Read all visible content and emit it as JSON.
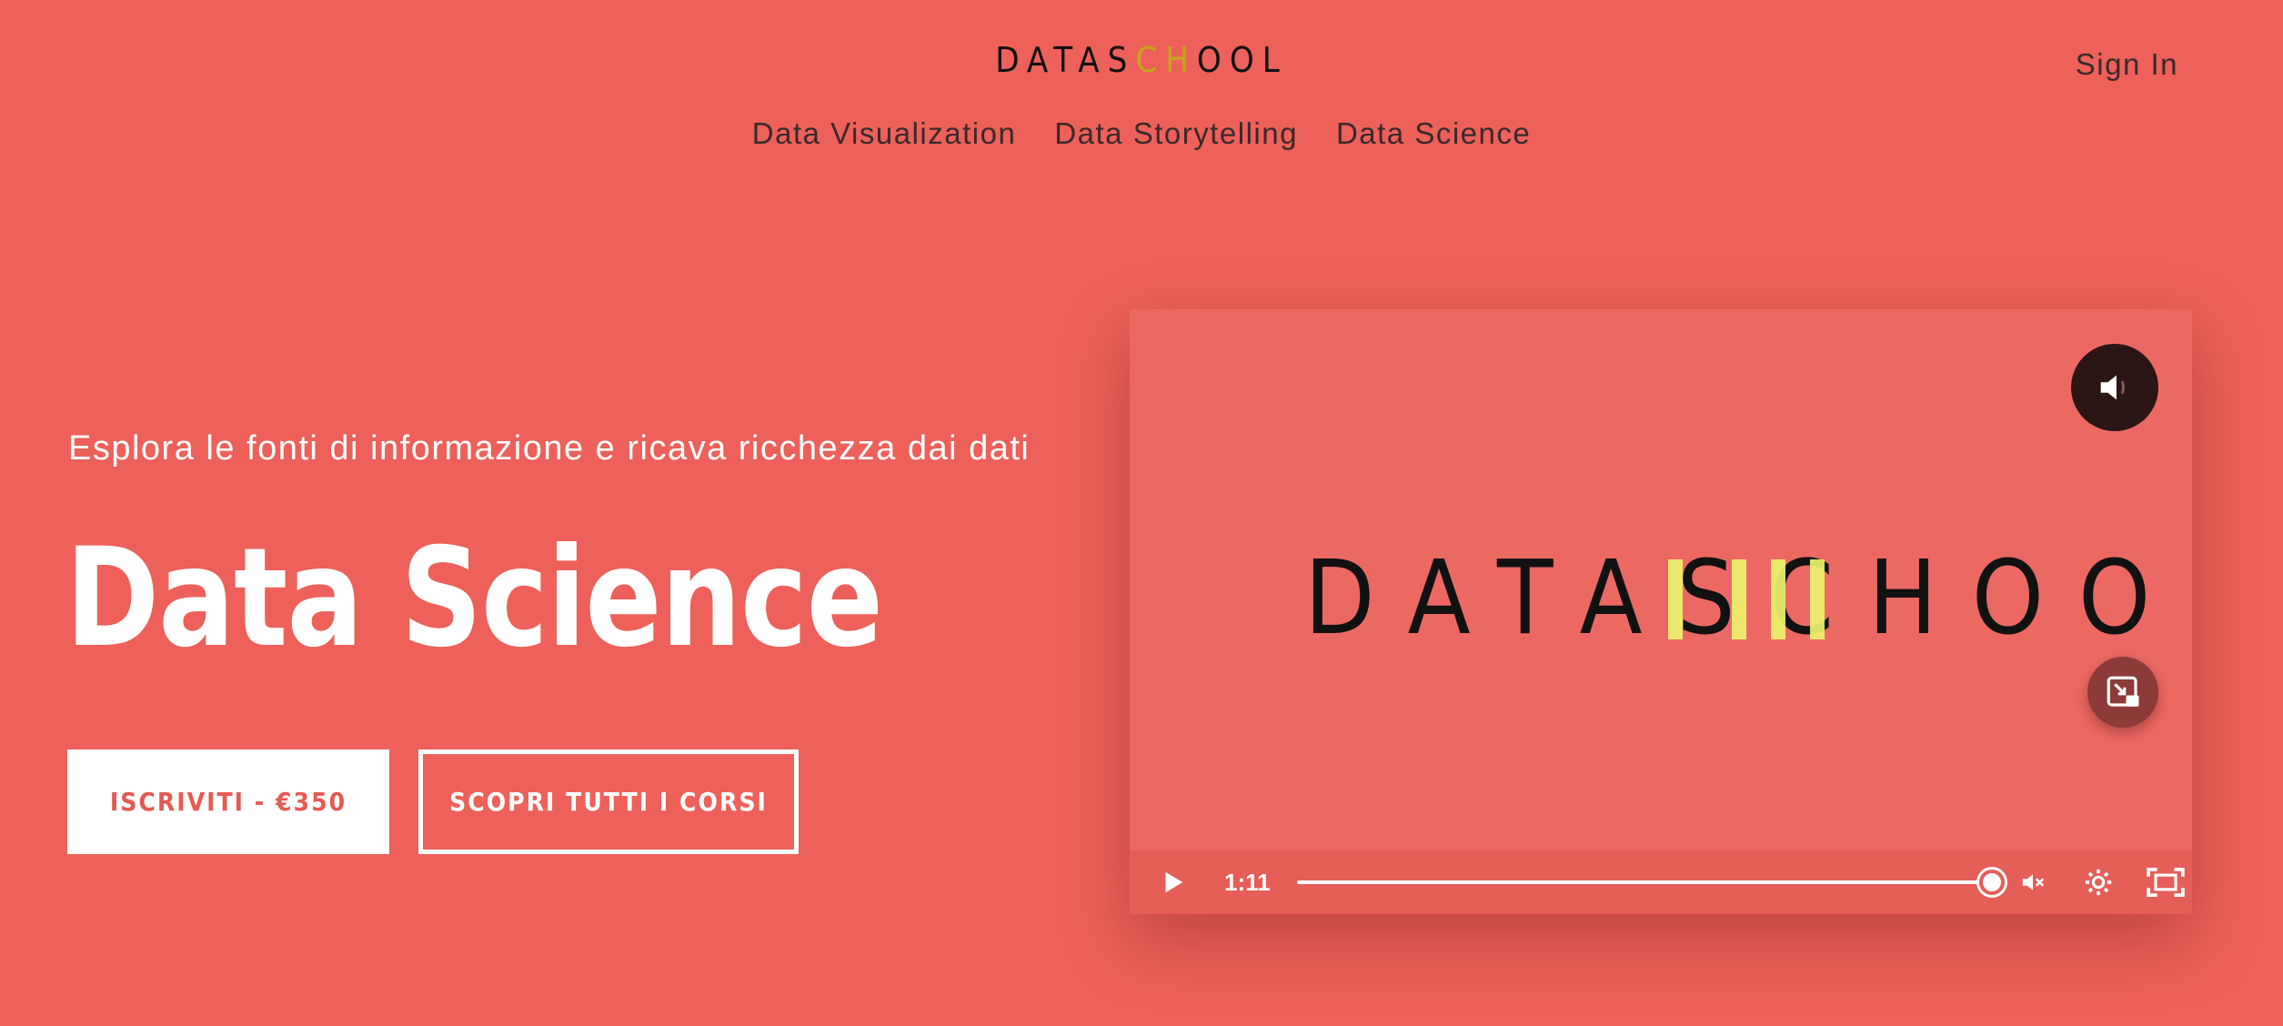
{
  "header": {
    "logo": {
      "before": "DATAS",
      "accent_c": "C",
      "accent_h": "H",
      "after": "OOL"
    },
    "sign_in": "Sign In",
    "nav": [
      "Data Visualization",
      "Data Storytelling",
      "Data Science"
    ]
  },
  "hero": {
    "subtitle": "Esplora le fonti di informazione e ricava ricchezza dai dati",
    "title": "Data Science",
    "primary_button": "ISCRIVITI - €350",
    "secondary_button": "SCOPRI TUTTI I CORSI"
  },
  "video": {
    "logo_text": "DATASCHOOL",
    "time": "1:11",
    "progress_fraction": 0.99,
    "icons": {
      "mute": "speaker-icon",
      "pip": "picture-in-picture-icon",
      "play": "play-icon",
      "volume": "volume-muted-icon",
      "settings": "gear-icon",
      "fullscreen": "fullscreen-icon"
    }
  },
  "colors": {
    "background": "#ed615a",
    "video_background": "#ec6963",
    "accent_yellow": "#ecf36b",
    "logo_accent": "#c6a61a"
  }
}
